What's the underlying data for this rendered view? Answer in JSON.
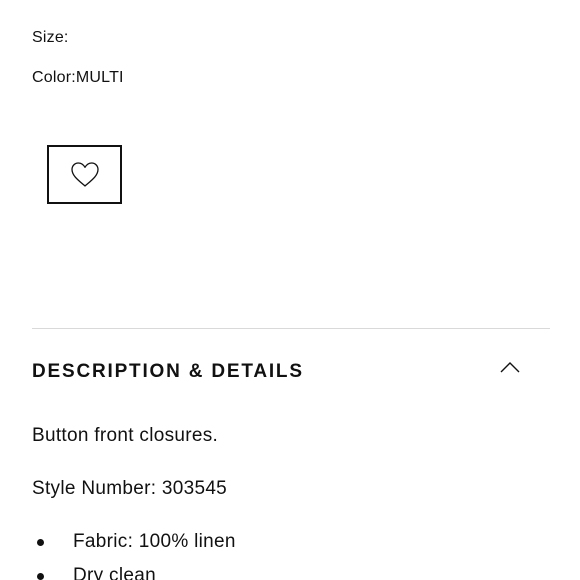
{
  "product": {
    "size_label": "Size:",
    "size_value": "",
    "color_label": "Color:",
    "color_value": "MULTI"
  },
  "wishlist": {
    "icon": "heart-outline-icon"
  },
  "description_section": {
    "title": "DESCRIPTION & DETAILS",
    "expanded": true,
    "toggle_icon": "chevron-up-icon",
    "paragraphs": [
      "Button front closures.",
      "Style Number: 303545"
    ],
    "bullets": [
      "Fabric: 100% linen",
      "Dry clean"
    ]
  }
}
